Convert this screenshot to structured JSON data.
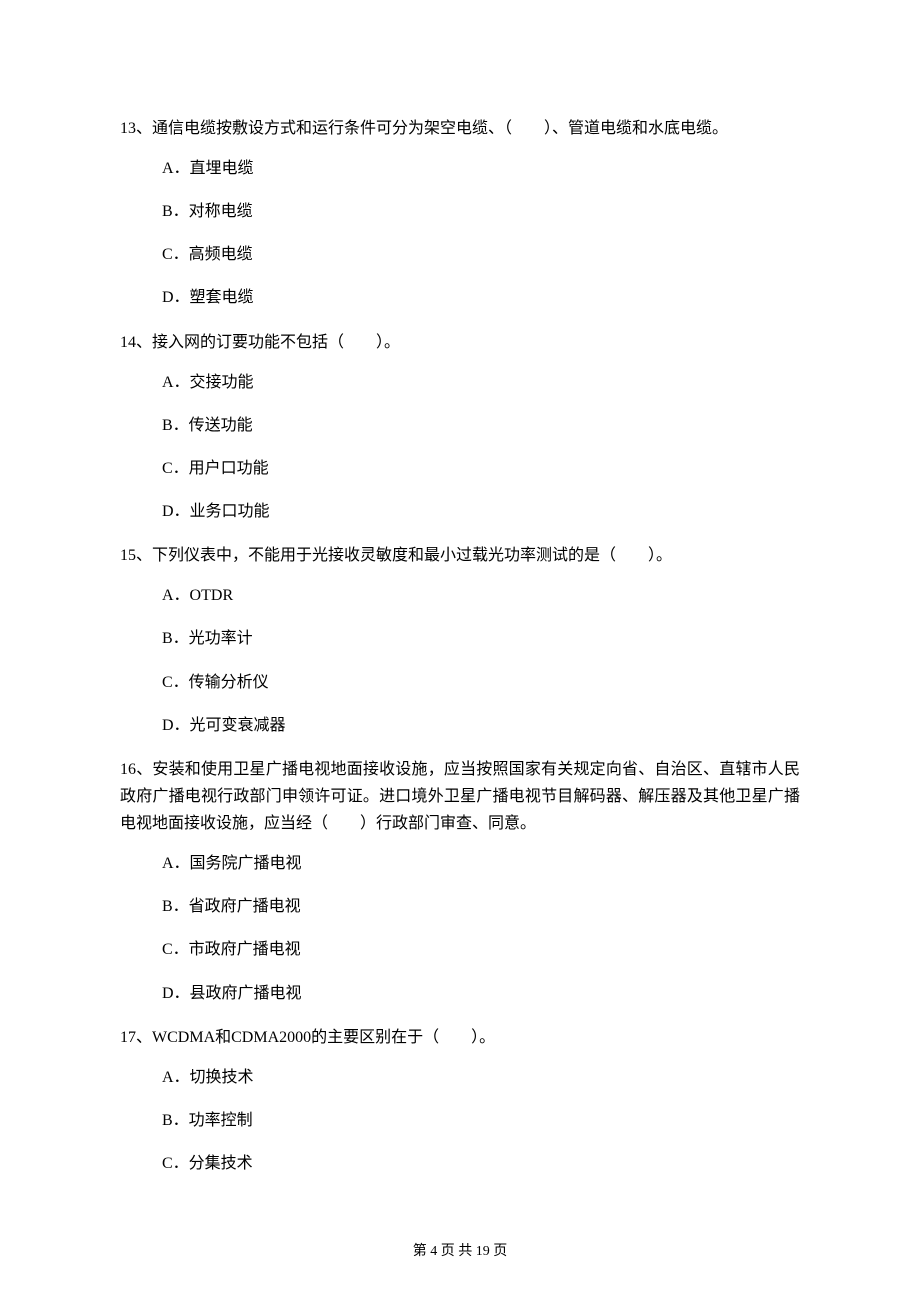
{
  "questions": [
    {
      "number": "13、",
      "text": "通信电缆按敷设方式和运行条件可分为架空电缆、（　　）、管道电缆和水底电缆。",
      "options": [
        "A．直埋电缆",
        "B．对称电缆",
        "C．高频电缆",
        "D．塑套电缆"
      ]
    },
    {
      "number": "14、",
      "text": "接入网的订要功能不包括（　　）。",
      "options": [
        "A．交接功能",
        "B．传送功能",
        "C．用户口功能",
        "D．业务口功能"
      ]
    },
    {
      "number": "15、",
      "text": "下列仪表中，不能用于光接收灵敏度和最小过载光功率测试的是（　　）。",
      "options": [
        "A．OTDR",
        "B．光功率计",
        "C．传输分析仪",
        "D．光可变衰减器"
      ]
    },
    {
      "number": "16、",
      "text": "安装和使用卫星广播电视地面接收设施，应当按照国家有关规定向省、自治区、直辖市人民政府广播电视行政部门申领许可证。进口境外卫星广播电视节目解码器、解压器及其他卫星广播电视地面接收设施，应当经（　　）行政部门审查、同意。",
      "options": [
        "A．国务院广播电视",
        "B．省政府广播电视",
        "C．市政府广播电视",
        "D．县政府广播电视"
      ]
    },
    {
      "number": "17、",
      "text": "WCDMA和CDMA2000的主要区别在于（　　）。",
      "options": [
        "A．切换技术",
        "B．功率控制",
        "C．分集技术"
      ]
    }
  ],
  "footer": "第 4 页 共 19 页"
}
